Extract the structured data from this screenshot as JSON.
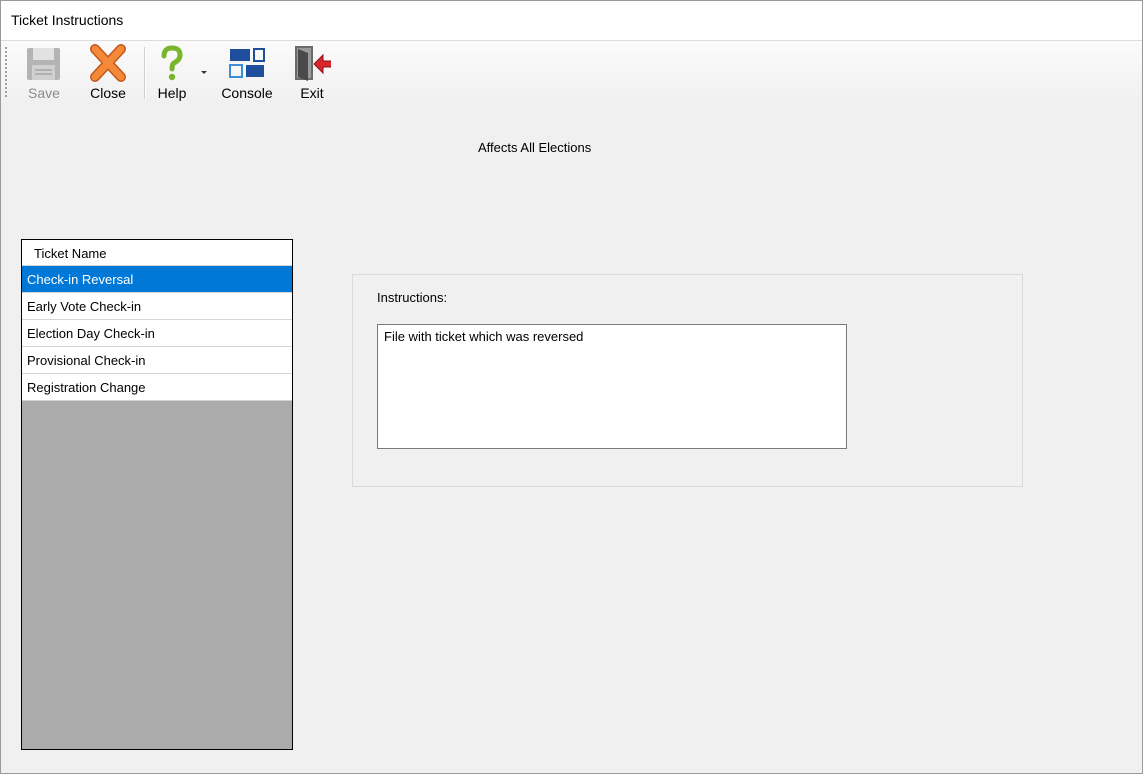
{
  "window": {
    "title": "Ticket Instructions"
  },
  "toolbar": {
    "save_label": "Save",
    "close_label": "Close",
    "help_label": "Help",
    "console_label": "Console",
    "exit_label": "Exit"
  },
  "header": {
    "scope_text": "Affects All Elections"
  },
  "grid": {
    "column_header": "Ticket Name",
    "rows": [
      {
        "label": "Check-in Reversal",
        "selected": true
      },
      {
        "label": "Early Vote Check-in"
      },
      {
        "label": "Election Day Check-in"
      },
      {
        "label": "Provisional Check-in"
      },
      {
        "label": "Registration Change"
      }
    ]
  },
  "instructions": {
    "label": "Instructions:",
    "text": "File with ticket which was reversed"
  },
  "colors": {
    "selection": "#0078d7",
    "grid_empty": "#ababab",
    "close_icon": "#f07a2a",
    "help_icon": "#7ab62d",
    "console_icon": "#1f4e9c",
    "exit_arrow": "#d9262b"
  },
  "icons": {
    "save": "floppy-disk-icon",
    "close": "orange-x-icon",
    "help": "green-question-icon",
    "console": "console-tiles-icon",
    "exit": "door-exit-icon"
  }
}
